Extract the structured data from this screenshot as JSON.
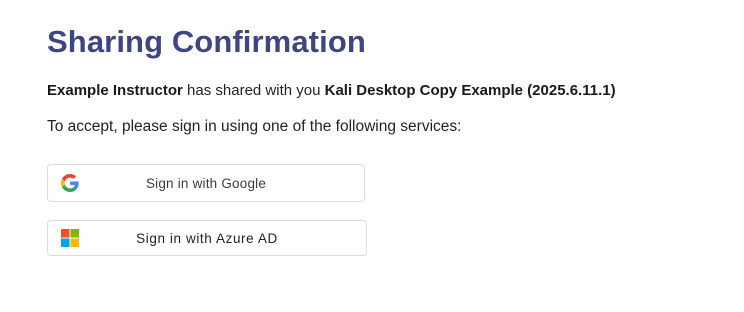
{
  "page": {
    "title": "Sharing Confirmation",
    "share_message": {
      "sharer": "Example Instructor",
      "middle_text": " has shared with you ",
      "item": "Kali Desktop Copy Example (2025.6.11.1)"
    },
    "instruction": "To accept, please sign in using one of the following services:"
  },
  "buttons": {
    "google": {
      "label": "Sign in with Google",
      "icon": "google-g-icon"
    },
    "azure": {
      "label": "Sign in with Azure AD",
      "icon": "microsoft-logo-icon"
    }
  },
  "colors": {
    "title": "#3d4683",
    "ms_red": "#f25022",
    "ms_green": "#7fba00",
    "ms_blue": "#00a4ef",
    "ms_yellow": "#ffb900"
  }
}
